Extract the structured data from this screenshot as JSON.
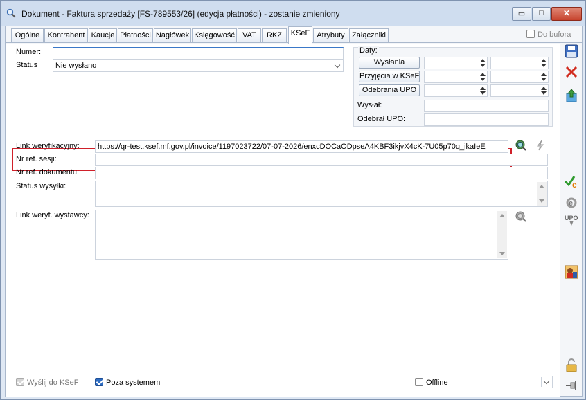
{
  "window": {
    "title": "Dokument - Faktura sprzedaży [FS-789553/26] (edycja płatności) - zostanie zmieniony",
    "min_label": "▭",
    "max_label": "□",
    "close_label": "✕"
  },
  "tabs": [
    "Ogólne",
    "Kontrahent",
    "Kaucje",
    "Płatności",
    "Nagłówek",
    "Księgowość",
    "VAT",
    "RKZ",
    "KSeF",
    "Atrybuty",
    "Załączniki"
  ],
  "active_tab": "KSeF",
  "do_bufora_label": "Do bufora",
  "form": {
    "numer_label": "Numer:",
    "numer_value": "",
    "status_label": "Status",
    "status_value": "Nie wysłano",
    "daty_label": "Daty:",
    "wyslania_label": "Wysłania",
    "przyjecia_label": "Przyjęcia w KSeF",
    "odebrania_label": "Odebrania UPO",
    "wyslal_label": "Wysłał:",
    "odebral_label": "Odebrał UPO:",
    "link_label": "Link weryfikacyjny:",
    "link_value": "https://qr-test.ksef.mf.gov.pl/invoice/1197023722/07-07-2026/enxcDOCaODpseA4KBF3ikjvX4cK-7U05p70q_ikaIeE",
    "nr_sesji_label": "Nr ref. sesji:",
    "nr_dok_label": "Nr ref. dokumentu:",
    "status_wysylki_label": "Status wysyłki:",
    "link_wystawcy_label": "Link weryf. wystawcy:"
  },
  "bottom": {
    "wyslij_label": "Wyślij do KSeF",
    "poza_label": "Poza systemem",
    "offline_label": "Offline"
  },
  "sidebar_icons": [
    "save-icon",
    "cancel-icon",
    "export-icon",
    "approve-icon",
    "refresh-icon",
    "upo-icon",
    "user-icon",
    "lock-icon",
    "pin-icon"
  ]
}
